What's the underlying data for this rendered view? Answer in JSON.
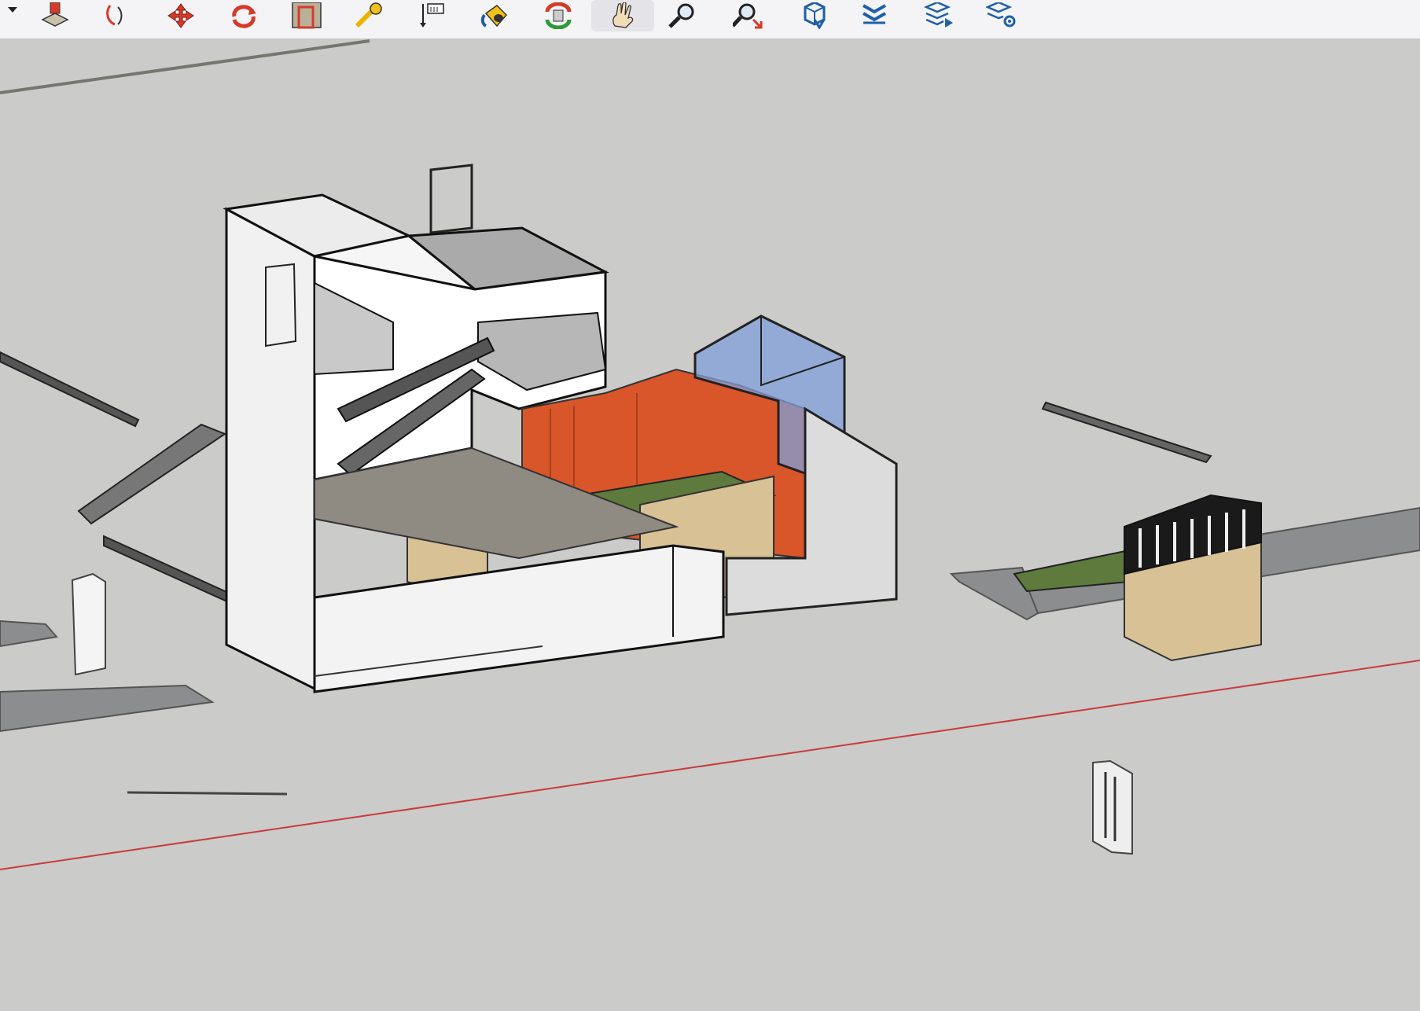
{
  "app": {
    "title": ""
  },
  "toolbar": {
    "tools": [
      {
        "name": "push-pull",
        "icon": "push-pull-icon"
      },
      {
        "name": "follow-me",
        "icon": "follow-me-icon"
      },
      {
        "name": "move",
        "icon": "move-icon"
      },
      {
        "name": "rotate",
        "icon": "rotate-icon"
      },
      {
        "name": "offset",
        "icon": "offset-icon"
      },
      {
        "name": "tape-measure",
        "icon": "tape-measure-icon"
      },
      {
        "name": "dimension",
        "icon": "dimension-icon"
      },
      {
        "name": "paint-bucket",
        "icon": "paint-bucket-icon"
      },
      {
        "name": "orbit",
        "icon": "orbit-icon"
      },
      {
        "name": "pan",
        "icon": "pan-hand-icon",
        "active": true
      },
      {
        "name": "zoom",
        "icon": "zoom-icon"
      },
      {
        "name": "zoom-extents",
        "icon": "zoom-extents-icon"
      },
      {
        "name": "3d-warehouse",
        "icon": "warehouse-icon"
      },
      {
        "name": "extension-warehouse",
        "icon": "extension-icon"
      },
      {
        "name": "layers",
        "icon": "layers-icon"
      },
      {
        "name": "layer-settings",
        "icon": "layer-settings-icon"
      }
    ]
  },
  "colors": {
    "background": "#cbcbc9",
    "toolbar": "#f4f4f6",
    "accent_red": "#d63a2a",
    "accent_blue": "#1e5fa8",
    "orange_wall": "#d9552a",
    "grass": "#5e7a3c",
    "stone": "#d8c194",
    "glass": "#7f9fd8",
    "axis_red": "#c93a3a"
  }
}
